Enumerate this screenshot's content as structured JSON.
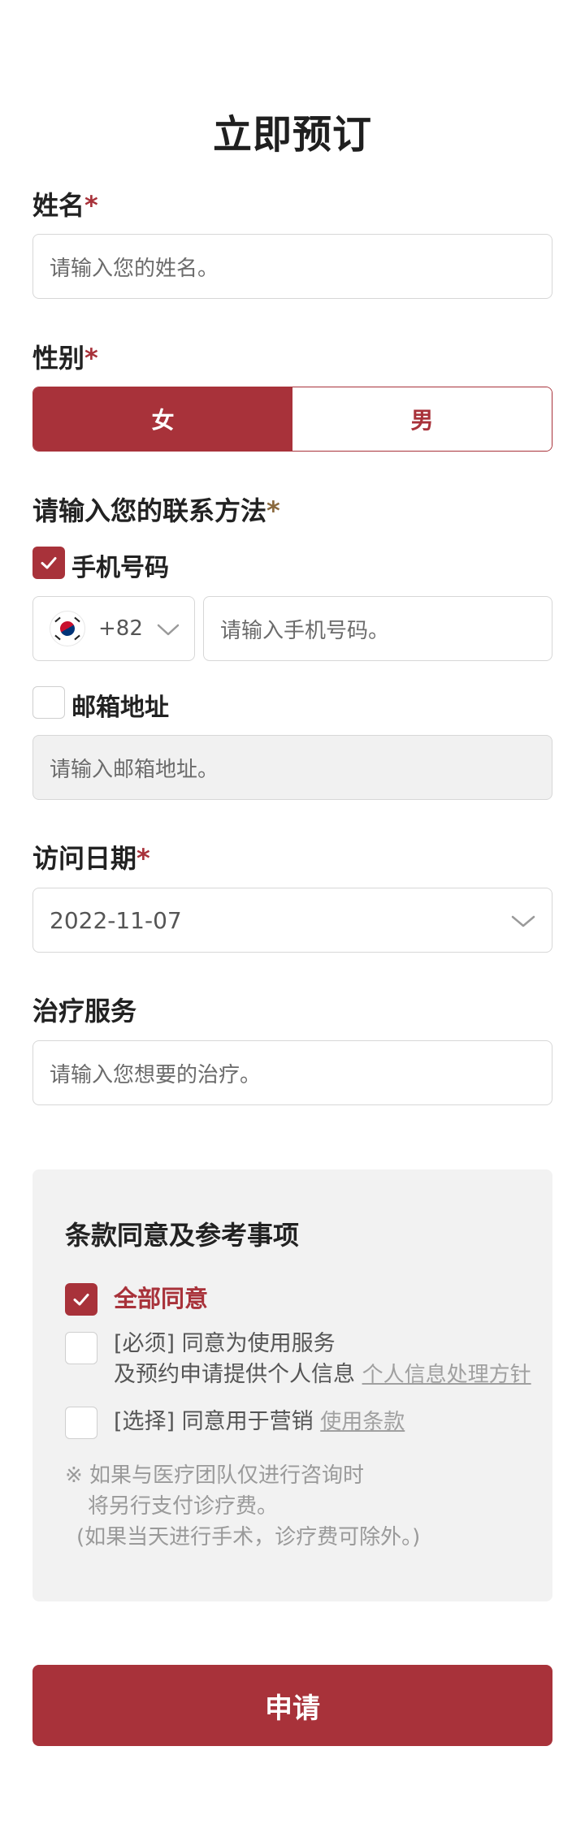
{
  "page": {
    "title": "立即预订"
  },
  "name_field": {
    "label": "姓名",
    "required_mark": "*",
    "placeholder": "请输入您的姓名。"
  },
  "gender_field": {
    "label": "性别",
    "required_mark": "*",
    "options": [
      "女",
      "男"
    ],
    "selected": "女"
  },
  "contact": {
    "label": "请输入您的联系方法",
    "required_mark": "*",
    "phone": {
      "checked": true,
      "label": "手机号码",
      "country_code": "+82",
      "country_icon": "korea-flag-icon",
      "placeholder": "请输入手机号码。"
    },
    "email": {
      "checked": false,
      "label": "邮箱地址",
      "placeholder": "请输入邮箱地址。"
    }
  },
  "visit_date": {
    "label": "访问日期",
    "required_mark": "*",
    "value": "2022-11-07"
  },
  "treatment": {
    "label": "治疗服务",
    "placeholder": "请输入您想要的治疗。"
  },
  "terms": {
    "title": "条款同意及参考事项",
    "agree_all": {
      "label": "全部同意",
      "checked": true
    },
    "required_item": {
      "line1": "[必须] 同意为使用服务",
      "line2": "及预约申请提供个人信息",
      "link": "个人信息处理方针",
      "checked": false
    },
    "optional_item": {
      "text": "[选择] 同意用于营销",
      "link": "使用条款",
      "checked": false
    },
    "note": {
      "line1": "※ 如果与医疗团队仅进行咨询时",
      "line2": "将另行支付诊疗费。",
      "line3": "(如果当天进行手术，诊疗费可除外。)"
    }
  },
  "submit": {
    "label": "申请"
  },
  "colors": {
    "accent": "#a8323a",
    "border": "#d7d7d7",
    "muted_bg": "#f2f2f2"
  }
}
